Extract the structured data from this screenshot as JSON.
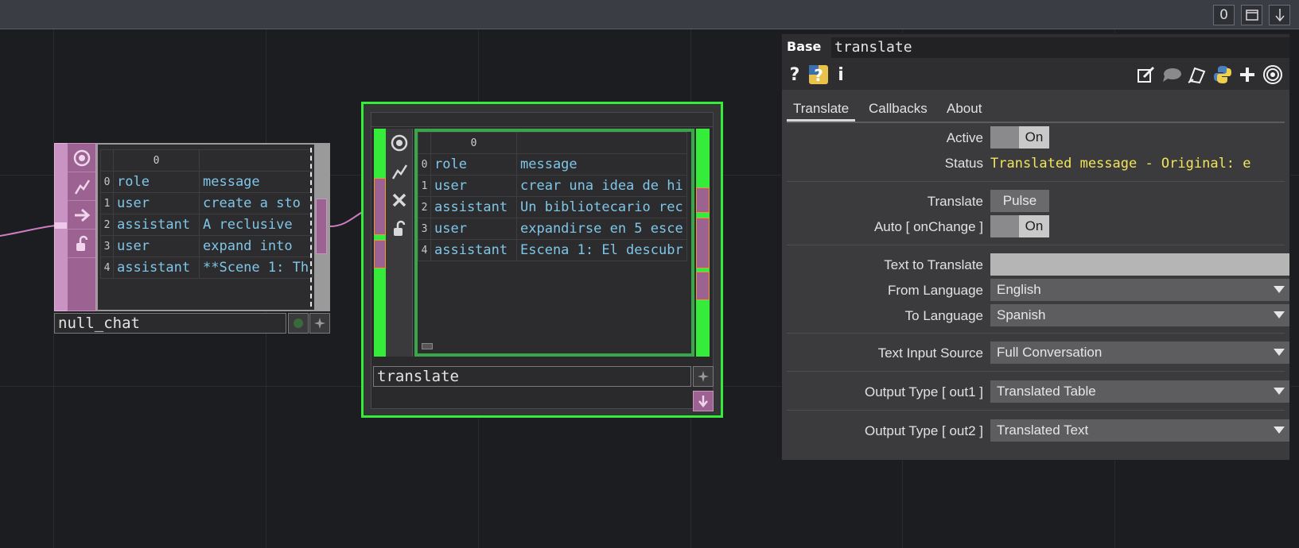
{
  "topbar": {
    "counter": "0"
  },
  "null_node": {
    "name": "null_chat",
    "header": "0",
    "rows": [
      {
        "idx": "0",
        "c0": "role",
        "c1": "message"
      },
      {
        "idx": "1",
        "c0": "user",
        "c1": "create a sto"
      },
      {
        "idx": "2",
        "c0": "assistant",
        "c1": "A reclusive "
      },
      {
        "idx": "3",
        "c0": "user",
        "c1": "expand into "
      },
      {
        "idx": "4",
        "c0": "assistant",
        "c1": "**Scene 1: Th"
      }
    ]
  },
  "translate_node": {
    "name": "translate",
    "header": "0",
    "rows": [
      {
        "idx": "0",
        "c0": "role",
        "c1": "message"
      },
      {
        "idx": "1",
        "c0": "user",
        "c1": "crear una idea de hi"
      },
      {
        "idx": "2",
        "c0": "assistant",
        "c1": "Un bibliotecario rec"
      },
      {
        "idx": "3",
        "c0": "user",
        "c1": "expandirse en 5 esce"
      },
      {
        "idx": "4",
        "c0": "assistant",
        "c1": "Escena 1: El descubr"
      }
    ]
  },
  "panel": {
    "base_label": "Base",
    "op_name": "translate",
    "tabs": [
      "Translate",
      "Callbacks",
      "About"
    ],
    "active_label": "Active",
    "active_value": "On",
    "status_label": "Status",
    "status_value": "Translated message - Original: e",
    "translate_label": "Translate",
    "translate_button": "Pulse",
    "auto_label": "Auto [ onChange ]",
    "auto_value": "On",
    "text_to_translate_label": "Text to Translate",
    "from_language_label": "From Language",
    "from_language_value": "English",
    "to_language_label": "To Language",
    "to_language_value": "Spanish",
    "text_input_source_label": "Text Input Source",
    "text_input_source_value": "Full Conversation",
    "output_type_out1_label": "Output Type [ out1 ]",
    "output_type_out1_value": "Translated Table",
    "output_type_out2_label": "Output Type [ out2 ]",
    "output_type_out2_value": "Translated Text",
    "icons": [
      "help-icon",
      "python-help-icon",
      "info-icon",
      "edit-icon",
      "comment-icon",
      "clone-icon",
      "python-icon",
      "add-icon",
      "target-icon"
    ]
  }
}
